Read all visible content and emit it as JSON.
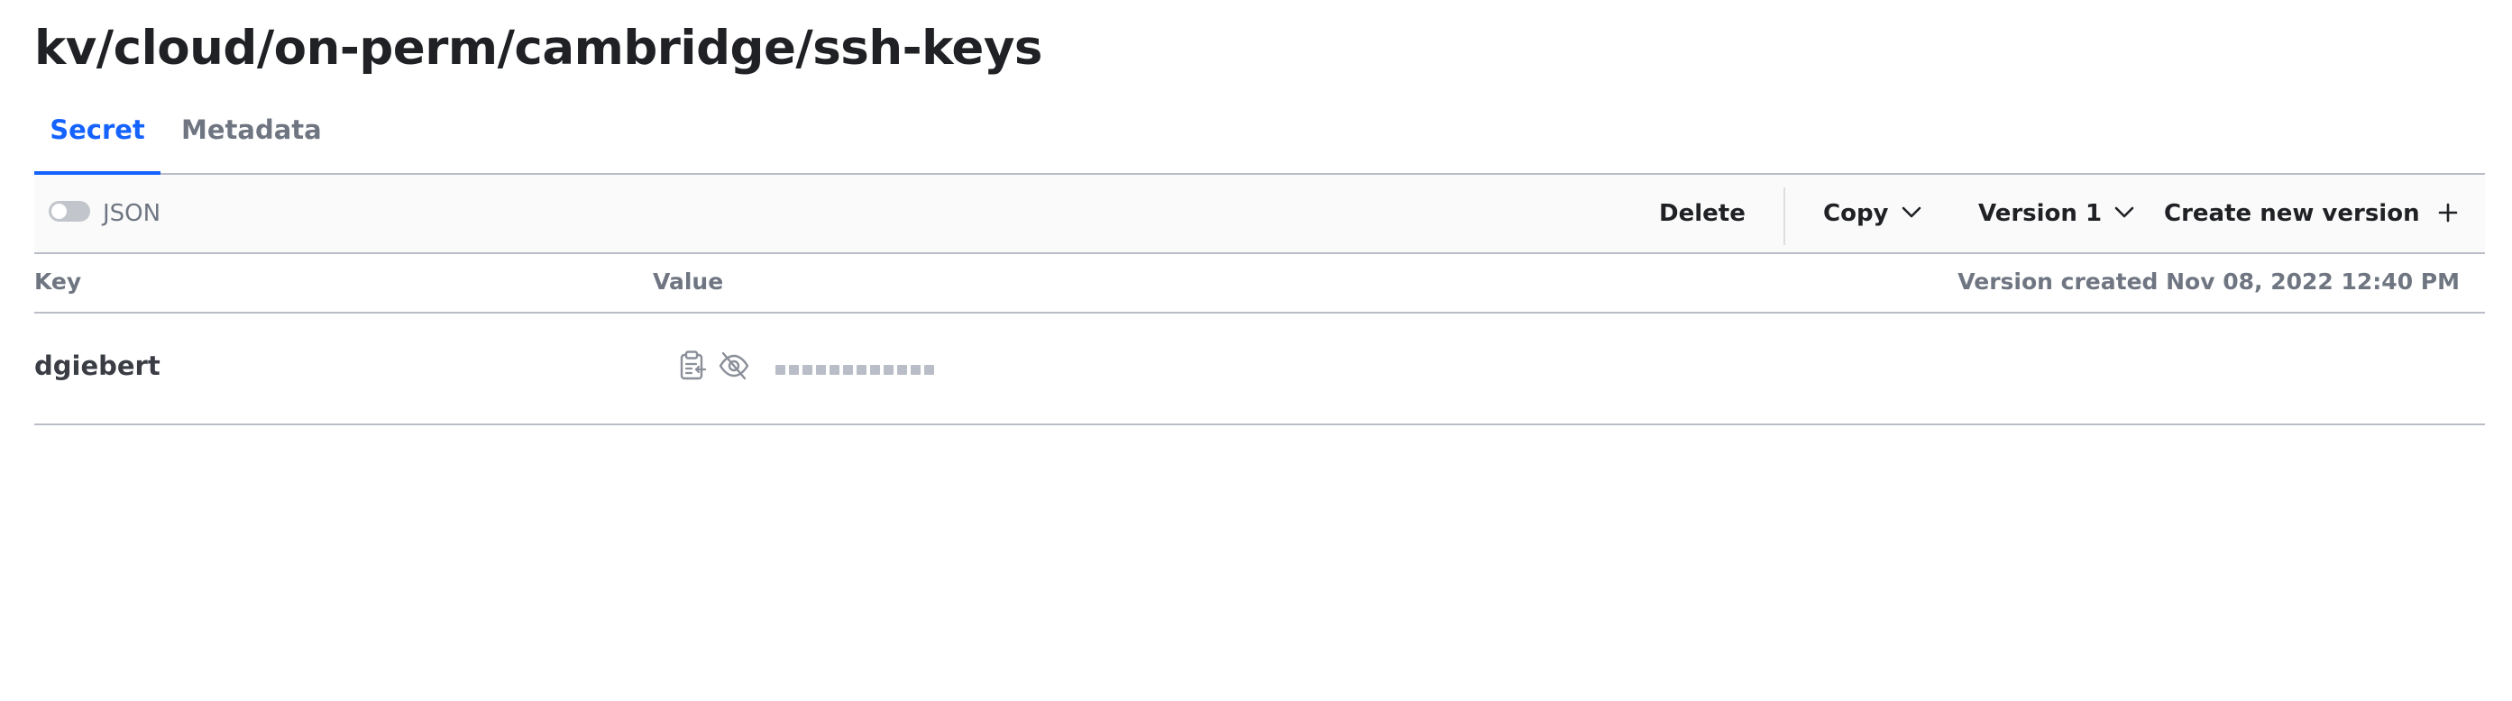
{
  "page": {
    "title": "kv/cloud/on-perm/cambridge/ssh-keys"
  },
  "tabs": [
    {
      "label": "Secret",
      "active": true
    },
    {
      "label": "Metadata",
      "active": false
    }
  ],
  "toolbar": {
    "json_toggle_label": "JSON",
    "json_toggle_on": false,
    "delete_label": "Delete",
    "copy_label": "Copy",
    "version_label": "Version 1",
    "create_label": "Create new version"
  },
  "table": {
    "headers": {
      "key": "Key",
      "value": "Value",
      "version_created": "Version created Nov 08, 2022 12:40 PM"
    },
    "rows": [
      {
        "key": "dgiebert",
        "value_hidden": true,
        "mask_length": 12
      }
    ]
  },
  "colors": {
    "accent": "#1563ff",
    "text": "#1f2124",
    "muted": "#6f7682",
    "border": "#b9bdc7",
    "toolbar_bg": "#fafafa"
  },
  "icons": {
    "copy": "clipboard-icon",
    "reveal": "eye-off-icon",
    "dropdown": "chevron-down-icon",
    "create": "plus-icon"
  }
}
